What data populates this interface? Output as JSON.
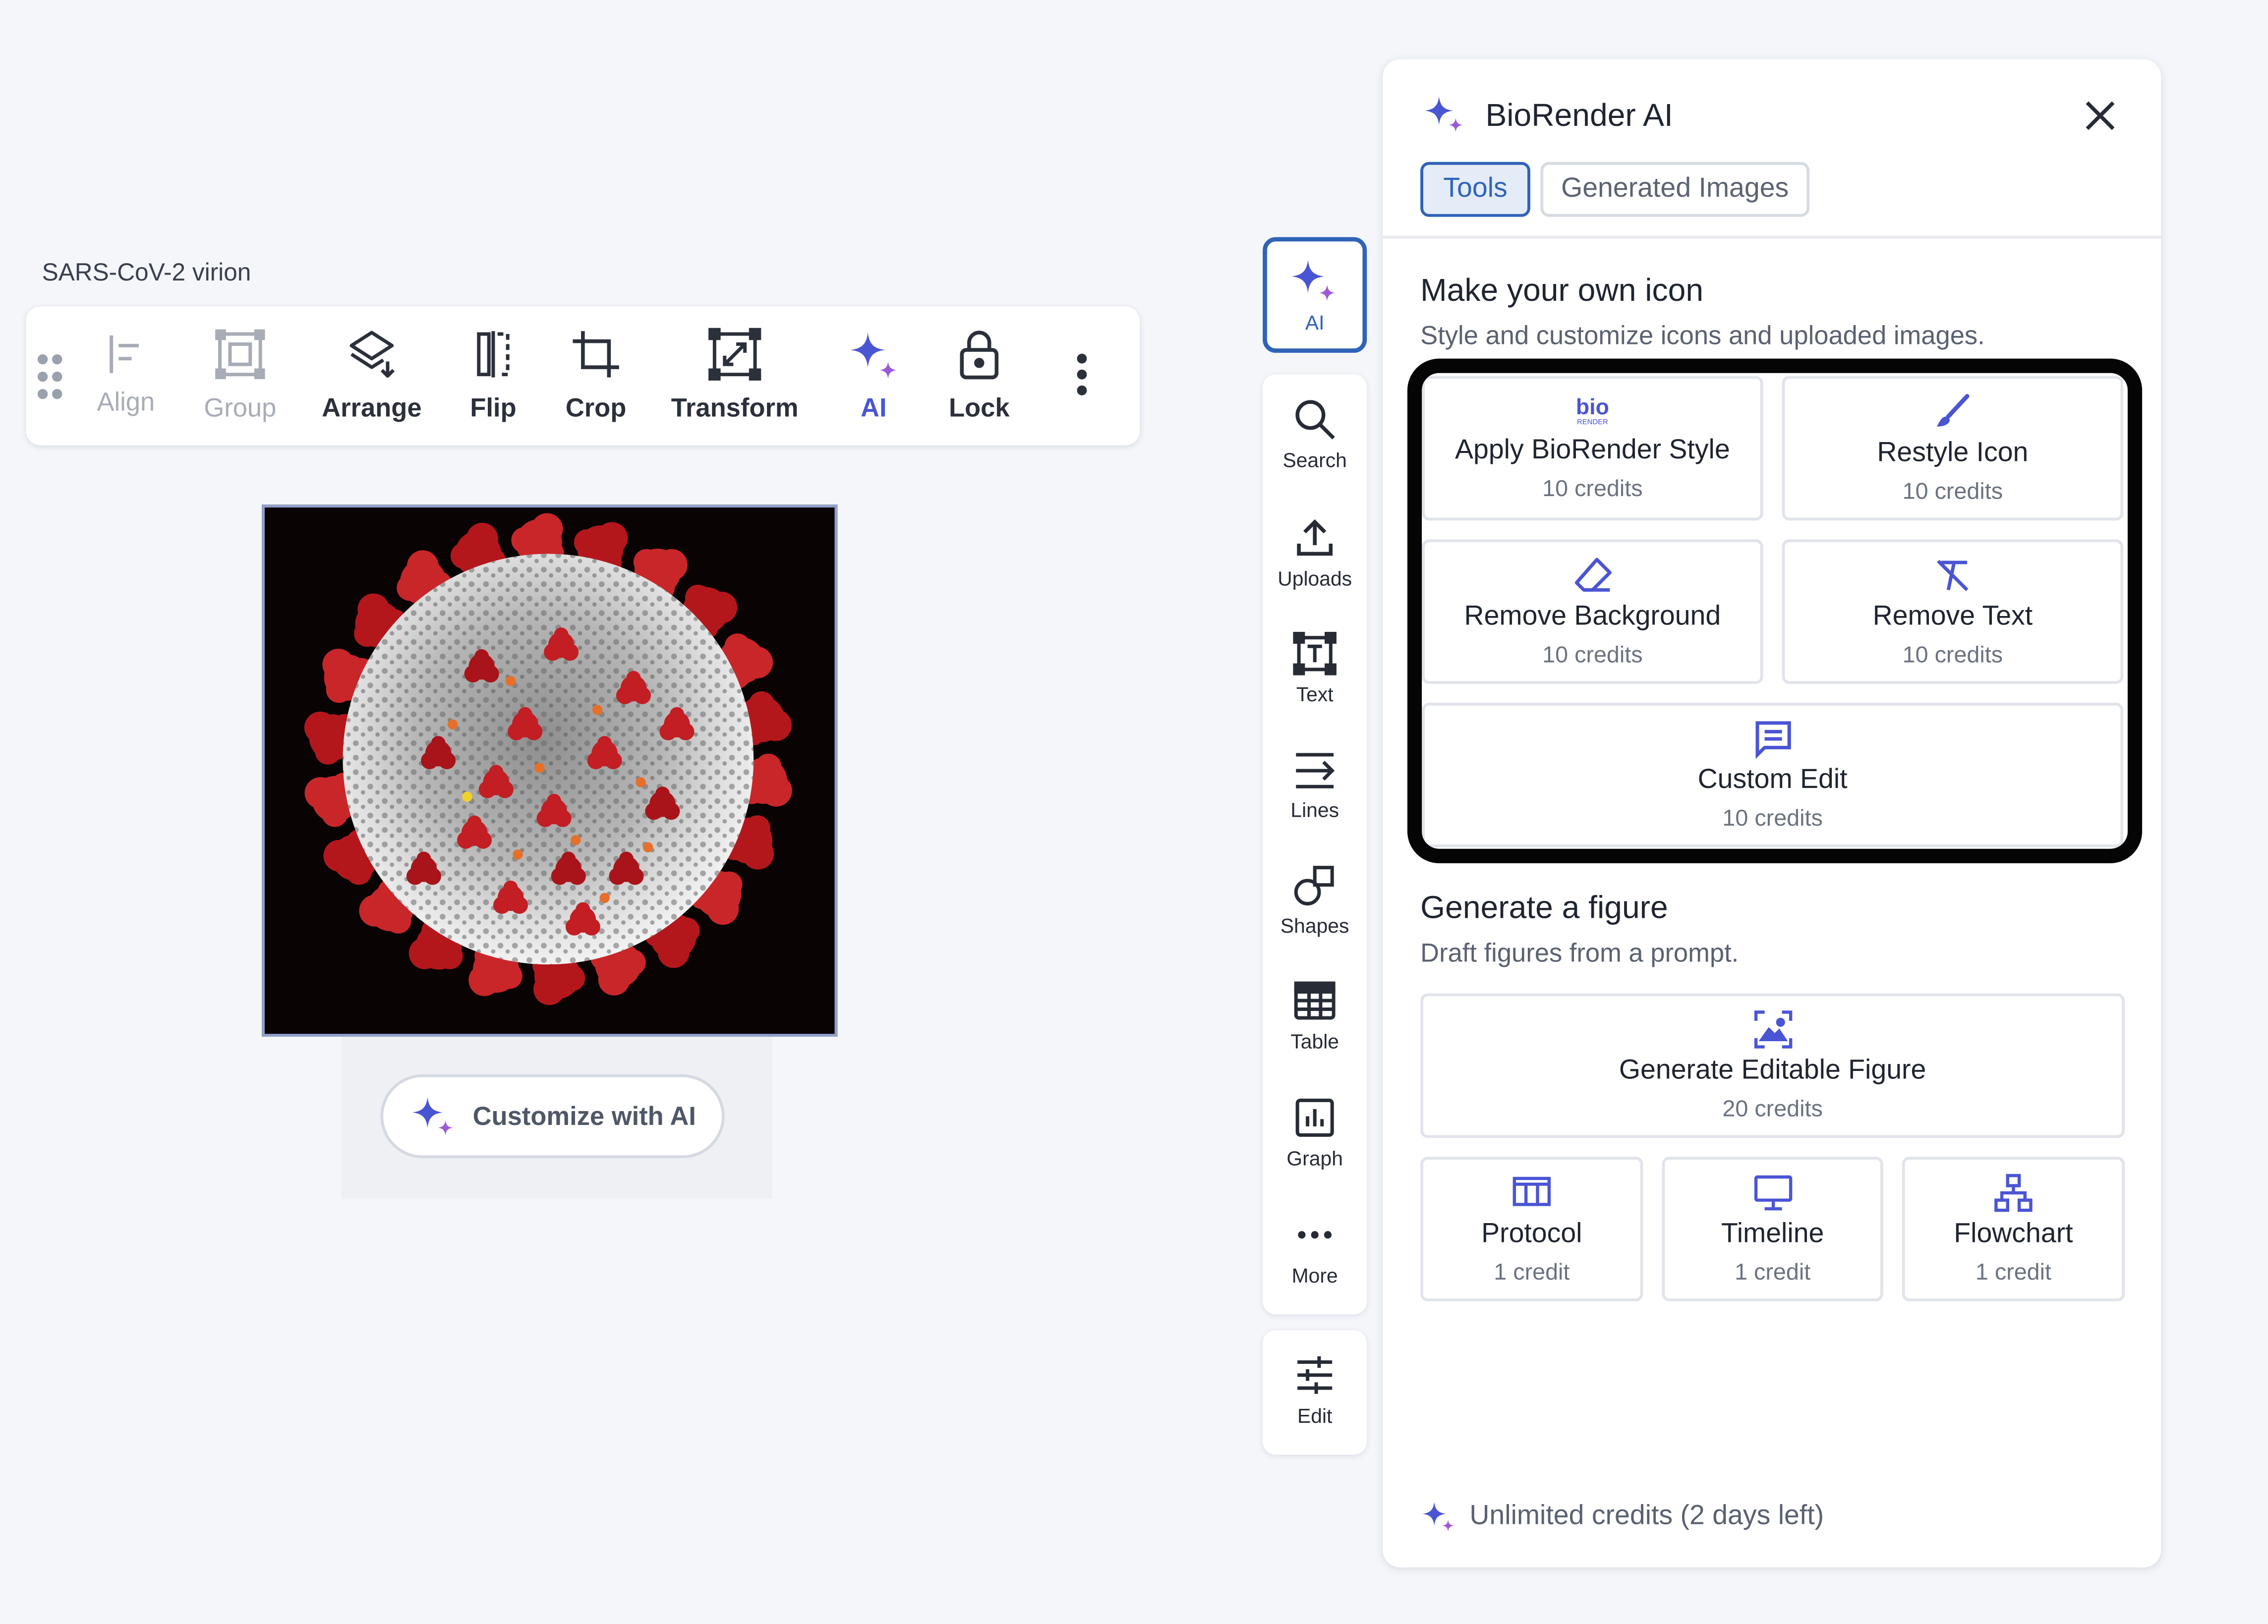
{
  "canvas": {
    "element_label": "SARS-CoV-2 virion",
    "customize_button": "Customize with AI"
  },
  "toolbar": {
    "items": [
      {
        "label": "Align",
        "icon": "align-icon",
        "enabled": false
      },
      {
        "label": "Group",
        "icon": "group-icon",
        "enabled": false
      },
      {
        "label": "Arrange",
        "icon": "arrange-icon",
        "enabled": true
      },
      {
        "label": "Flip",
        "icon": "flip-icon",
        "enabled": true
      },
      {
        "label": "Crop",
        "icon": "crop-icon",
        "enabled": true
      },
      {
        "label": "Transform",
        "icon": "transform-icon",
        "enabled": true
      },
      {
        "label": "AI",
        "icon": "ai-sparkle-icon",
        "enabled": true
      },
      {
        "label": "Lock",
        "icon": "lock-icon",
        "enabled": true
      }
    ]
  },
  "sidebar": {
    "active": {
      "label": "AI",
      "icon": "ai-sparkle-icon"
    },
    "items": [
      {
        "label": "Search",
        "icon": "search-icon"
      },
      {
        "label": "Uploads",
        "icon": "upload-icon"
      },
      {
        "label": "Text",
        "icon": "text-icon"
      },
      {
        "label": "Lines",
        "icon": "lines-icon"
      },
      {
        "label": "Shapes",
        "icon": "shapes-icon"
      },
      {
        "label": "Table",
        "icon": "table-icon"
      },
      {
        "label": "Graph",
        "icon": "graph-icon"
      },
      {
        "label": "More",
        "icon": "more-icon"
      }
    ],
    "edit": {
      "label": "Edit",
      "icon": "sliders-icon"
    }
  },
  "panel": {
    "title": "BioRender AI",
    "tabs": [
      {
        "label": "Tools",
        "active": true
      },
      {
        "label": "Generated Images",
        "active": false
      }
    ],
    "icon_section": {
      "title": "Make your own icon",
      "subtitle": "Style and customize icons and uploaded images.",
      "cards": [
        {
          "title": "Apply BioRender Style",
          "credits": "10 credits",
          "icon": "biorender-logo-icon",
          "logo_text": "bio",
          "logo_subtext": "RENDER"
        },
        {
          "title": "Restyle Icon",
          "credits": "10 credits",
          "icon": "brush-icon"
        },
        {
          "title": "Remove Background",
          "credits": "10 credits",
          "icon": "eraser-icon"
        },
        {
          "title": "Remove Text",
          "credits": "10 credits",
          "icon": "remove-text-icon"
        },
        {
          "title": "Custom Edit",
          "credits": "10 credits",
          "icon": "message-icon"
        }
      ]
    },
    "figure_section": {
      "title": "Generate a figure",
      "subtitle": "Draft figures from a prompt.",
      "cards": [
        {
          "title": "Generate Editable Figure",
          "credits": "20 credits",
          "icon": "image-frame-icon"
        },
        {
          "title": "Protocol",
          "credits": "1 credit",
          "icon": "columns-icon"
        },
        {
          "title": "Timeline",
          "credits": "1 credit",
          "icon": "monitor-icon"
        },
        {
          "title": "Flowchart",
          "credits": "1 credit",
          "icon": "flowchart-icon"
        }
      ]
    },
    "footer": "Unlimited credits (2 days left)"
  },
  "colors": {
    "accent": "#2f63b8",
    "ai_purple": "#4a55d4",
    "background": "#f4f6fa"
  }
}
